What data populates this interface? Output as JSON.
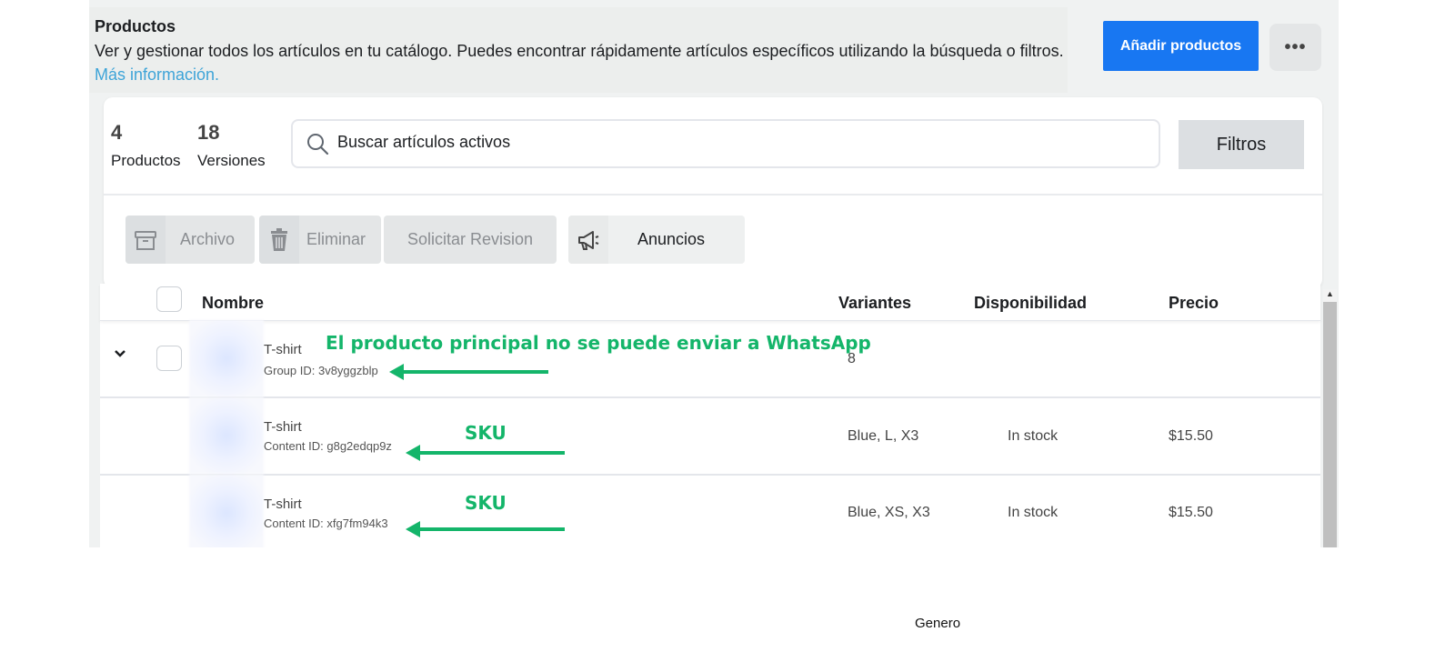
{
  "header": {
    "title": "Productos",
    "description": "Ver y gestionar todos los artículos en tu catálogo. Puedes encontrar rápidamente artículos específicos utilizando la búsqueda o filtros.",
    "more_info_link": "Más información.",
    "add_button": "Añadir productos",
    "more_button": "•••"
  },
  "stats": {
    "products_count": "4",
    "products_label": "Productos",
    "versions_count": "18",
    "versions_label": "Versiones"
  },
  "search": {
    "placeholder": "Buscar artículos activos"
  },
  "filters_button": "Filtros",
  "actions": {
    "archive": "Archivo",
    "delete": "Eliminar",
    "request_review": "Solicitar Revision",
    "ads": "Anuncios"
  },
  "table": {
    "headers": {
      "name": "Nombre",
      "variants": "Variantes",
      "availability": "Disponibilidad",
      "price": "Precio"
    },
    "rows": [
      {
        "name": "T-shirt",
        "id": "Group ID: 3v8yggzblp",
        "variants": "8",
        "availability": "",
        "price": ""
      },
      {
        "name": "T-shirt",
        "id": "Content ID: g8g2edqp9z",
        "variants": "Blue, L, X3",
        "availability": "In stock",
        "price": "$15.50"
      },
      {
        "name": "T-shirt",
        "id": "Content ID: xfg7fm94k3",
        "variants": "Blue, XS, X3",
        "availability": "In stock",
        "price": "$15.50"
      }
    ]
  },
  "annotations": {
    "parent_note": "El producto principal no se puede enviar a WhatsApp",
    "sku_1": "SKU",
    "sku_2": "SKU",
    "color": "#14b56a"
  },
  "footer_text": "Genero",
  "colors": {
    "primary": "#1877f2",
    "link": "#3ea4d8"
  }
}
